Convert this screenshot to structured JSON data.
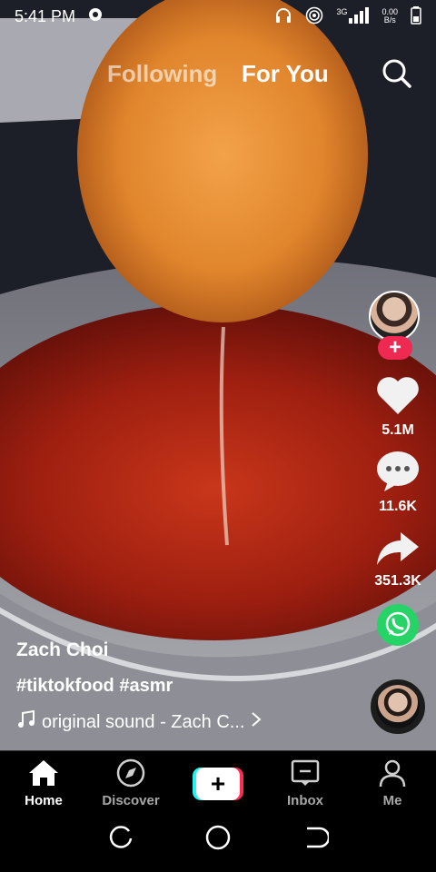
{
  "status_bar": {
    "time": "5:41 PM",
    "network": "3G",
    "net_speed_value": "0.00",
    "net_speed_unit": "B/s"
  },
  "tabs": {
    "following": "Following",
    "for_you": "For You"
  },
  "creator": {
    "like_count": "5.1M",
    "comment_count": "11.6K",
    "share_count": "351.3K"
  },
  "caption": {
    "username": "Zach Choi",
    "hashtags": "#tiktokfood #asmr",
    "sound": "original sound - Zach C..."
  },
  "nav": {
    "home": "Home",
    "discover": "Discover",
    "inbox": "Inbox",
    "me": "Me"
  },
  "colors": {
    "accent_red": "#fe2c55",
    "accent_cyan": "#25f4ee",
    "whatsapp_green": "#25d366"
  },
  "icons": [
    "eye-icon",
    "headphones-icon",
    "hotspot-icon",
    "signal-icon",
    "battery-icon",
    "search-icon",
    "heart-icon",
    "comment-icon",
    "share-icon",
    "whatsapp-icon",
    "music-note-icon",
    "chevron-right-icon",
    "home-icon",
    "compass-icon",
    "plus-icon",
    "inbox-icon",
    "person-icon",
    "recent-apps-icon",
    "home-circle-icon",
    "back-icon"
  ]
}
